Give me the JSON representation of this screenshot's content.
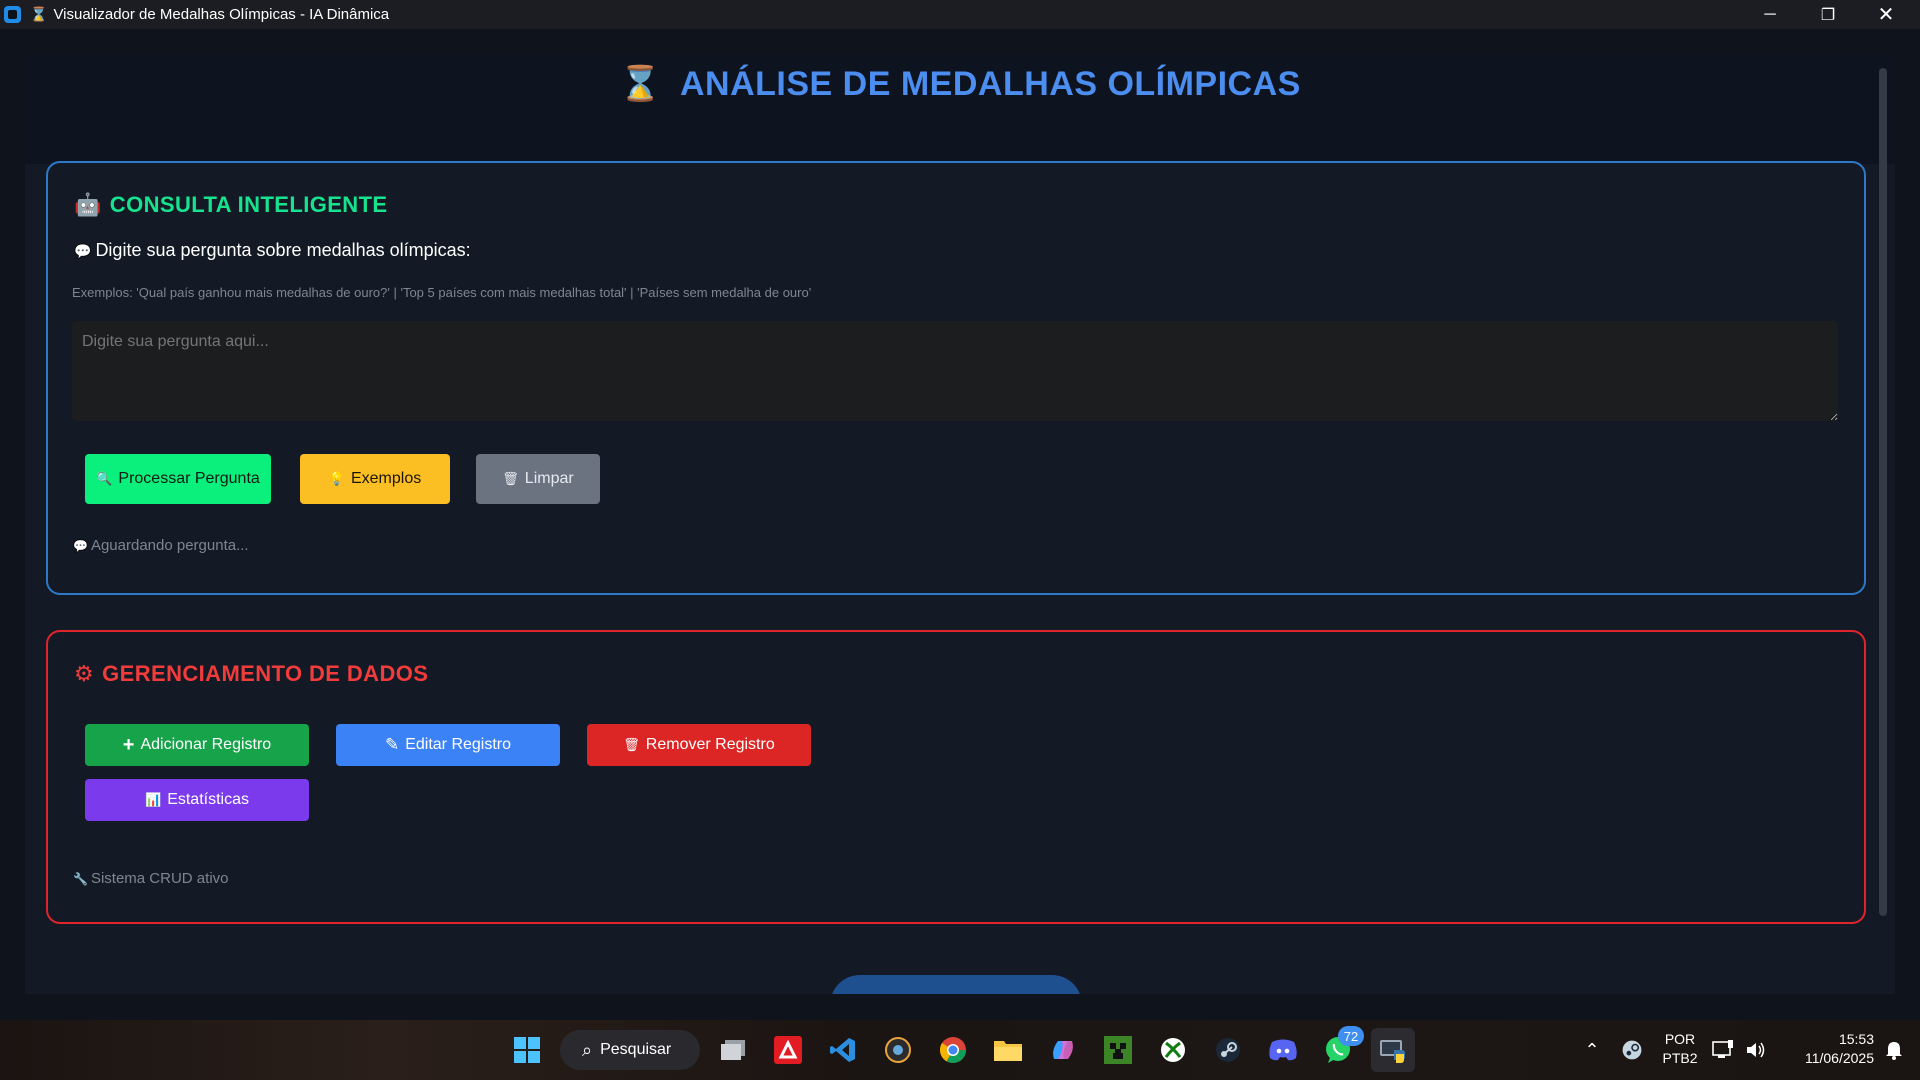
{
  "window": {
    "title": "Visualizador de Medalhas Olímpicas - IA Dinâmica",
    "title_icon": "⌛",
    "controls": {
      "minimize": "─",
      "maximize": "❐",
      "close": "✕"
    }
  },
  "header": {
    "icon": "⌛",
    "title": "ANÁLISE DE MEDALHAS OLÍMPICAS"
  },
  "consulta": {
    "icon": "🤖",
    "title": "CONSULTA INTELIGENTE",
    "prompt_icon": "💬",
    "prompt_label": "Digite sua pergunta sobre medalhas olímpicas:",
    "examples_line": "Exemplos: 'Qual país ganhou mais medalhas de ouro?' | 'Top 5 países com mais medalhas total' | 'Países sem medalha de ouro'",
    "input_placeholder": "Digite sua pergunta aqui...",
    "buttons": {
      "process": {
        "icon": "🔍",
        "label": "Processar Pergunta"
      },
      "examples": {
        "icon": "💡",
        "label": "Exemplos"
      },
      "clear": {
        "icon": "🗑",
        "label": "Limpar"
      }
    },
    "status_icon": "💬",
    "status": "Aguardando pergunta..."
  },
  "gerenciamento": {
    "icon": "⚙",
    "title": "GERENCIAMENTO DE DADOS",
    "buttons": {
      "add": {
        "icon": "+",
        "label": "Adicionar Registro"
      },
      "edit": {
        "icon": "✎",
        "label": "Editar Registro"
      },
      "remove": {
        "icon": "🗑",
        "label": "Remover Registro"
      },
      "stats": {
        "icon": "📊",
        "label": "Estatísticas"
      }
    },
    "status_icon": "🔧",
    "status": "Sistema CRUD ativo"
  },
  "taskbar": {
    "search_label": "Pesquisar",
    "whatsapp_badge": "72",
    "language": {
      "line1": "POR",
      "line2": "PTB2"
    },
    "time": "15:53",
    "date": "11/06/2025"
  }
}
